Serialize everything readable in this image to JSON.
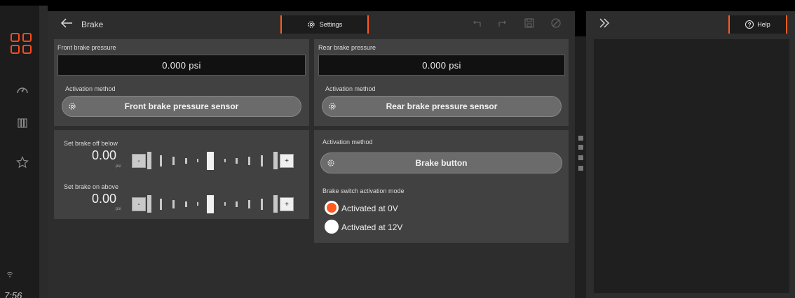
{
  "status": {
    "time": "7:56"
  },
  "header": {
    "title": "Brake",
    "settings_tab": "Settings",
    "help_tab": "Help"
  },
  "front": {
    "label": "Front brake pressure",
    "value": "0.000 psi",
    "activation_label": "Activation method",
    "activation_value": "Front brake pressure sensor"
  },
  "rear": {
    "label": "Rear brake pressure",
    "value": "0.000 psi",
    "activation_label": "Activation method",
    "activation_value": "Rear brake pressure sensor"
  },
  "thresholds": {
    "off": {
      "label": "Set brake off below",
      "value": "0.00",
      "unit": "psi",
      "minus": "-",
      "plus": "+"
    },
    "on": {
      "label": "Set brake on above",
      "value": "0.00",
      "unit": "psi",
      "minus": "-",
      "plus": "+"
    }
  },
  "button_card": {
    "activation_label": "Activation method",
    "activation_value": "Brake button",
    "mode_label": "Brake switch activation mode",
    "options": [
      {
        "label": "Activated at 0V",
        "selected": true
      },
      {
        "label": "Activated at 12V",
        "selected": false
      }
    ]
  },
  "colors": {
    "accent": "#ff5a1f",
    "panel": "#2d2d2d",
    "card": "#414141"
  }
}
